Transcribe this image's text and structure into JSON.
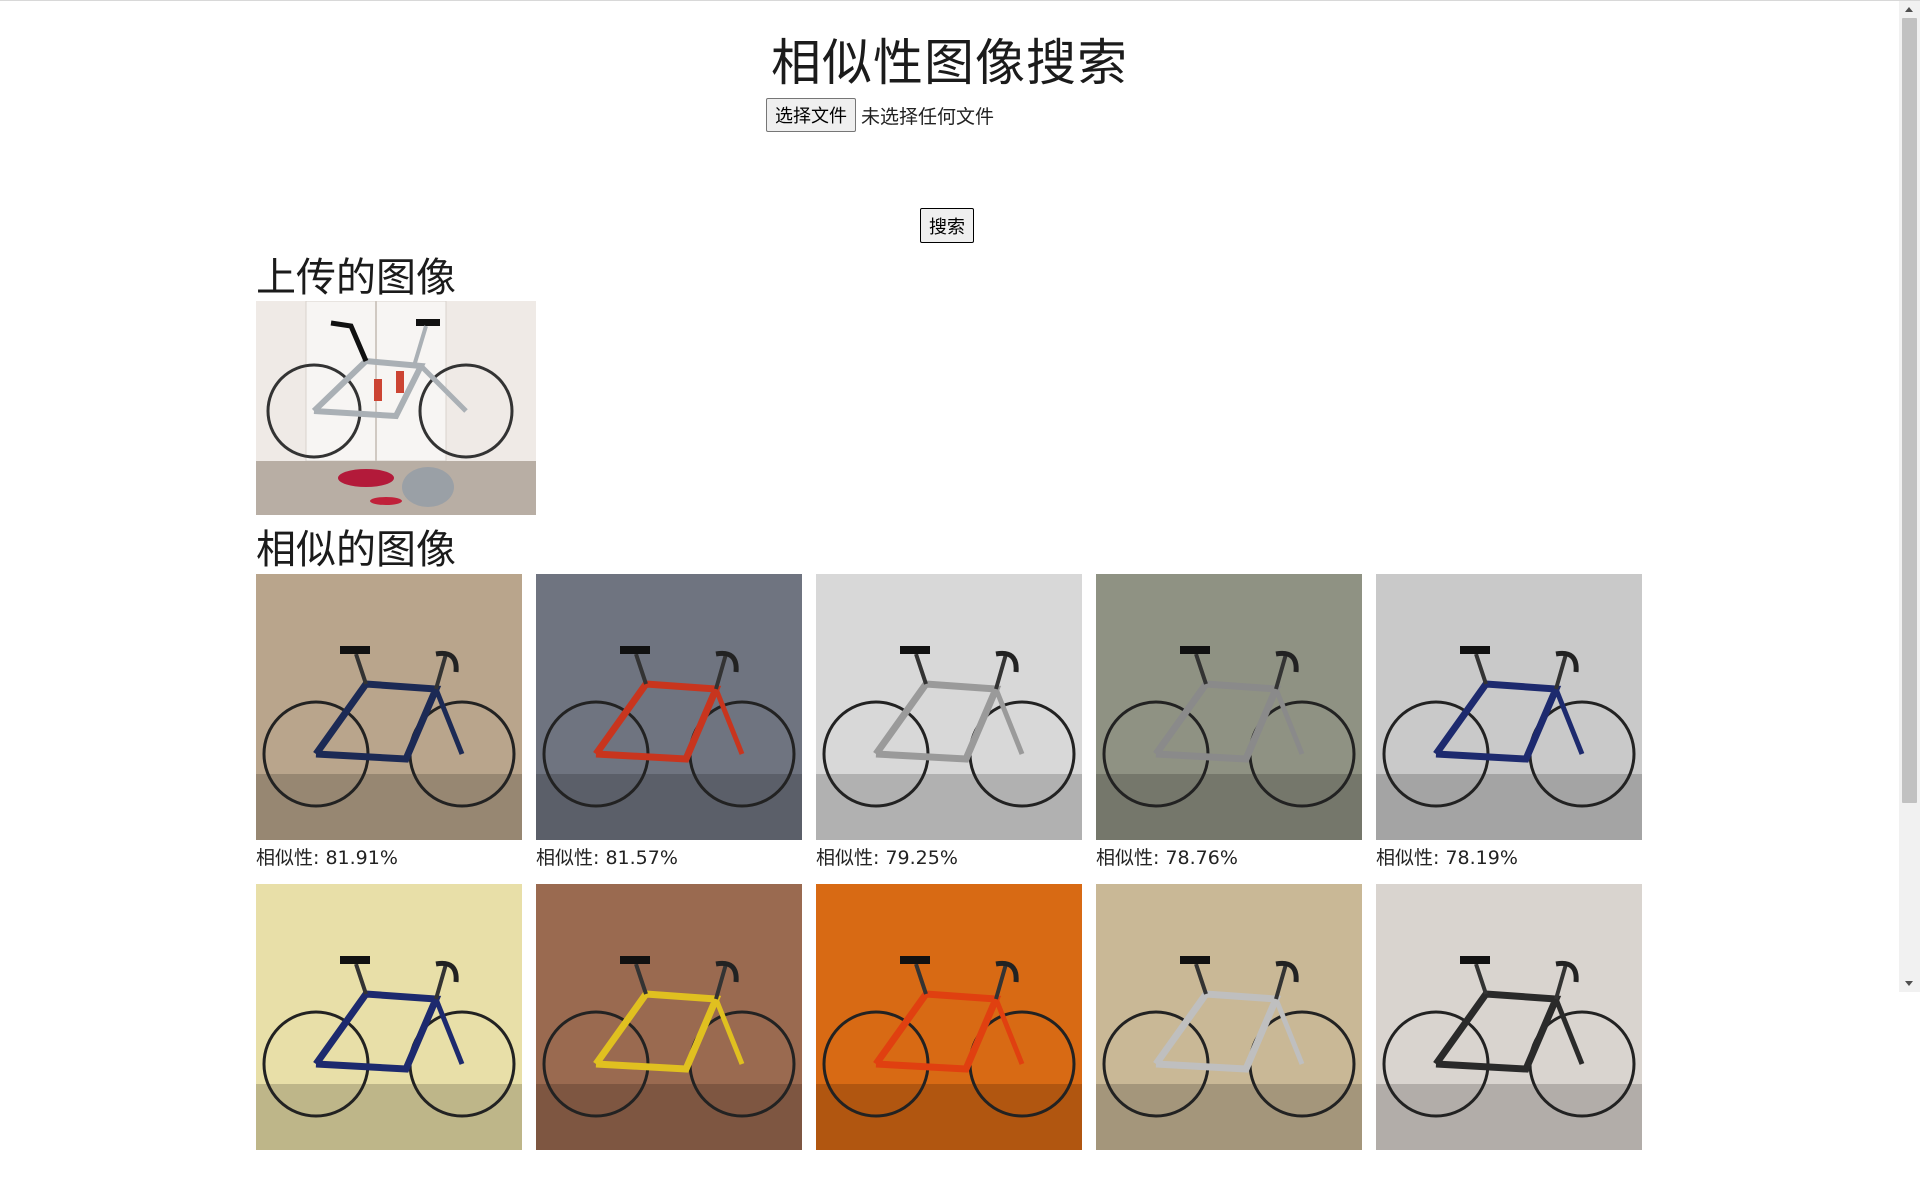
{
  "header": {
    "title": "相似性图像搜索"
  },
  "upload_form": {
    "choose_file_label": "选择文件",
    "file_status": "未选择任何文件",
    "search_label": "搜索"
  },
  "uploaded_section": {
    "heading": "上传的图像",
    "image_icon": "bicycle-photo"
  },
  "similar_section": {
    "heading": "相似的图像",
    "results": [
      {
        "similarity": "相似性: 81.91%",
        "bg": "#b9a58c",
        "frame": "#1c2a55"
      },
      {
        "similarity": "相似性: 81.57%",
        "bg": "#6f7480",
        "frame": "#c8351e"
      },
      {
        "similarity": "相似性: 79.25%",
        "bg": "#d8d8d8",
        "frame": "#9a9a9a"
      },
      {
        "similarity": "相似性: 78.76%",
        "bg": "#8f9283",
        "frame": "#8a8a8a"
      },
      {
        "similarity": "相似性: 78.19%",
        "bg": "#c9c9c9",
        "frame": "#1d2a6e"
      },
      {
        "similarity": "",
        "bg": "#e8dfa8",
        "frame": "#1d2a6e"
      },
      {
        "similarity": "",
        "bg": "#9a6a50",
        "frame": "#e0c020"
      },
      {
        "similarity": "",
        "bg": "#d86a14",
        "frame": "#e04010"
      },
      {
        "similarity": "",
        "bg": "#c9b896",
        "frame": "#bfbfbf"
      },
      {
        "similarity": "",
        "bg": "#d9d4cf",
        "frame": "#2a2a2a"
      }
    ]
  }
}
